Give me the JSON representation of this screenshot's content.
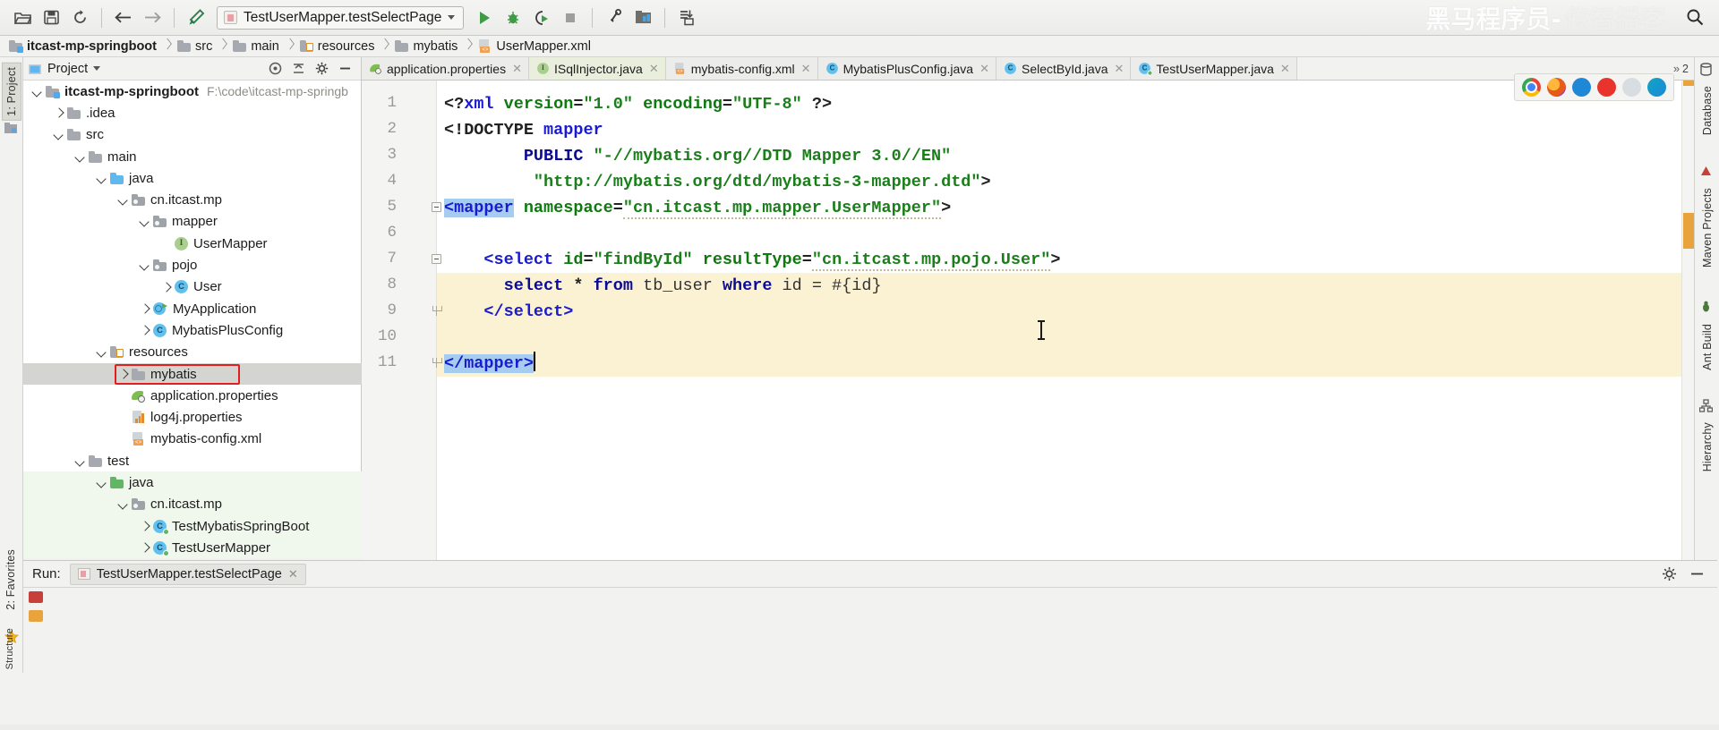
{
  "toolbar": {
    "icons": [
      "open-folder-icon",
      "save-all-icon",
      "sync-icon",
      "back-arrow-icon",
      "forward-arrow-icon",
      "build-hammer-icon"
    ],
    "run_configuration": "TestUserMapper.testSelectPage",
    "run_label": "Run",
    "debug_label": "Debug",
    "run_coverage_label": "Run with Coverage",
    "stop_label": "Stop",
    "settings_label": "Settings",
    "project_structure_label": "Project Structure",
    "update_label": "Update",
    "search_label": "Search Everywhere",
    "watermark": "黑马程序员-",
    "watermark_faint": "传智播客"
  },
  "breadcrumb": [
    {
      "label": "itcast-mp-springboot",
      "icon": "module-folder-icon"
    },
    {
      "label": "src",
      "icon": "folder-icon"
    },
    {
      "label": "main",
      "icon": "folder-icon"
    },
    {
      "label": "resources",
      "icon": "resources-folder-icon"
    },
    {
      "label": "mybatis",
      "icon": "folder-icon"
    },
    {
      "label": "UserMapper.xml",
      "icon": "xml-file-icon"
    }
  ],
  "left_strip": {
    "project_tab": "1: Project",
    "structure_tab": "Structure",
    "favorites_tab": "2: Favorites"
  },
  "right_strip": {
    "database_tab": "Database",
    "maven_tab": "Maven Projects",
    "ant_tab": "Ant Build",
    "hierarchy_tab": "Hierarchy"
  },
  "project_panel": {
    "title": "Project",
    "collapse_icon": "collapse-all-icon",
    "locate_icon": "scroll-from-source-icon",
    "settings_icon": "gear-icon",
    "hide_icon": "hide-icon",
    "tree": [
      {
        "depth": 0,
        "arrow": "down",
        "icon": "module-folder-icon",
        "label": "itcast-mp-springboot",
        "bold": true,
        "path": "F:\\code\\itcast-mp-springb"
      },
      {
        "depth": 1,
        "arrow": "right",
        "icon": "folder-icon",
        "label": ".idea"
      },
      {
        "depth": 1,
        "arrow": "down",
        "icon": "folder-icon",
        "label": "src"
      },
      {
        "depth": 2,
        "arrow": "down",
        "icon": "folder-icon",
        "label": "main"
      },
      {
        "depth": 3,
        "arrow": "down",
        "icon": "source-folder-icon",
        "label": "java"
      },
      {
        "depth": 4,
        "arrow": "down",
        "icon": "package-icon",
        "label": "cn.itcast.mp"
      },
      {
        "depth": 5,
        "arrow": "down",
        "icon": "package-icon",
        "label": "mapper"
      },
      {
        "depth": 6,
        "arrow": "none",
        "icon": "interface-icon",
        "label": "UserMapper"
      },
      {
        "depth": 5,
        "arrow": "down",
        "icon": "package-icon",
        "label": "pojo"
      },
      {
        "depth": 6,
        "arrow": "right",
        "icon": "class-icon",
        "label": "User"
      },
      {
        "depth": 5,
        "arrow": "right",
        "icon": "spring-app-icon",
        "label": "MyApplication"
      },
      {
        "depth": 5,
        "arrow": "right",
        "icon": "class-icon",
        "label": "MybatisPlusConfig"
      },
      {
        "depth": 3,
        "arrow": "down",
        "icon": "resources-folder-icon",
        "label": "resources"
      },
      {
        "depth": 4,
        "arrow": "right",
        "icon": "folder-icon",
        "label": "mybatis",
        "selected": true,
        "annotated": true
      },
      {
        "depth": 4,
        "arrow": "none",
        "icon": "properties-icon",
        "label": "application.properties"
      },
      {
        "depth": 4,
        "arrow": "none",
        "icon": "log4j-icon",
        "label": "log4j.properties"
      },
      {
        "depth": 4,
        "arrow": "none",
        "icon": "xml-file-icon",
        "label": "mybatis-config.xml"
      },
      {
        "depth": 2,
        "arrow": "down",
        "icon": "folder-icon",
        "label": "test"
      },
      {
        "depth": 3,
        "arrow": "down",
        "icon": "test-folder-icon",
        "label": "java",
        "testbg": true
      },
      {
        "depth": 4,
        "arrow": "down",
        "icon": "package-icon",
        "label": "cn.itcast.mp",
        "testbg": true
      },
      {
        "depth": 5,
        "arrow": "right",
        "icon": "test-class-icon",
        "label": "TestMybatisSpringBoot",
        "testbg": true
      },
      {
        "depth": 5,
        "arrow": "right",
        "icon": "test-class-icon",
        "label": "TestUserMapper",
        "testbg": true
      }
    ]
  },
  "editor": {
    "tabs": [
      {
        "label": "application.properties",
        "icon": "properties-icon",
        "active": false
      },
      {
        "label": "ISqlInjector.java",
        "icon": "interface-icon",
        "active": true
      },
      {
        "label": "mybatis-config.xml",
        "icon": "xml-file-icon",
        "active": false
      },
      {
        "label": "MybatisPlusConfig.java",
        "icon": "class-icon",
        "active": false
      },
      {
        "label": "SelectById.java",
        "icon": "class-icon",
        "active": false
      },
      {
        "label": "TestUserMapper.java",
        "icon": "test-class-icon",
        "active": false
      }
    ],
    "tab_overflow_count": "2",
    "browsers": [
      "chrome-icon",
      "firefox-icon",
      "edge-legacy-icon",
      "opera-icon",
      "safari-icon",
      "edge-icon"
    ],
    "line_numbers": [
      "1",
      "2",
      "3",
      "4",
      "5",
      "6",
      "7",
      "8",
      "9",
      "10",
      "11"
    ],
    "lines": [
      {
        "n": 1,
        "segments": [
          {
            "t": "<?",
            "c": "punc"
          },
          {
            "t": "xml",
            "c": "tag"
          },
          {
            "t": " ",
            "c": "plain"
          },
          {
            "t": "version",
            "c": "attr"
          },
          {
            "t": "=",
            "c": "punc"
          },
          {
            "t": "\"1.0\"",
            "c": "val"
          },
          {
            "t": " ",
            "c": "plain"
          },
          {
            "t": "encoding",
            "c": "attr"
          },
          {
            "t": "=",
            "c": "punc"
          },
          {
            "t": "\"UTF-8\"",
            "c": "val"
          },
          {
            "t": " ?>",
            "c": "punc"
          }
        ]
      },
      {
        "n": 2,
        "segments": [
          {
            "t": "<!DOCTYPE ",
            "c": "punc"
          },
          {
            "t": "mapper",
            "c": "tag"
          }
        ]
      },
      {
        "n": 3,
        "segments": [
          {
            "t": "        ",
            "c": "plain"
          },
          {
            "t": "PUBLIC",
            "c": "dark"
          },
          {
            "t": " ",
            "c": "plain"
          },
          {
            "t": "\"-//mybatis.org//DTD Mapper 3.0//EN\"",
            "c": "val"
          }
        ]
      },
      {
        "n": 4,
        "segments": [
          {
            "t": "         ",
            "c": "plain"
          },
          {
            "t": "\"http://mybatis.org/dtd/mybatis-3-mapper.dtd\"",
            "c": "val"
          },
          {
            "t": ">",
            "c": "punc"
          }
        ]
      },
      {
        "n": 5,
        "segments": [
          {
            "t": "<mapper",
            "c": "tag",
            "sel": true
          },
          {
            "t": " ",
            "c": "plain"
          },
          {
            "t": "namespace",
            "c": "attr"
          },
          {
            "t": "=",
            "c": "punc"
          },
          {
            "t": "\"cn.itcast.mp.mapper.UserMapper\"",
            "c": "val",
            "squiggle": true
          },
          {
            "t": ">",
            "c": "punc"
          }
        ]
      },
      {
        "n": 6,
        "segments": []
      },
      {
        "n": 7,
        "segments": [
          {
            "t": "    ",
            "c": "plain"
          },
          {
            "t": "<select ",
            "c": "tag"
          },
          {
            "t": "id",
            "c": "attr"
          },
          {
            "t": "=",
            "c": "punc"
          },
          {
            "t": "\"findById\"",
            "c": "val"
          },
          {
            "t": " ",
            "c": "plain"
          },
          {
            "t": "resultType",
            "c": "attr"
          },
          {
            "t": "=",
            "c": "punc"
          },
          {
            "t": "\"cn.itcast.mp.pojo.User\"",
            "c": "val",
            "squiggle": true
          },
          {
            "t": ">",
            "c": "punc"
          }
        ]
      },
      {
        "n": 8,
        "highlight": true,
        "segments": [
          {
            "t": "      ",
            "c": "plain"
          },
          {
            "t": "select",
            "c": "kw"
          },
          {
            "t": " * ",
            "c": "punc"
          },
          {
            "t": "from",
            "c": "kw"
          },
          {
            "t": " ",
            "c": "plain"
          },
          {
            "t": "tb_user",
            "c": "plain"
          },
          {
            "t": " ",
            "c": "plain"
          },
          {
            "t": "where",
            "c": "kw"
          },
          {
            "t": " ",
            "c": "plain"
          },
          {
            "t": "id = #{id}",
            "c": "plain"
          }
        ]
      },
      {
        "n": 9,
        "highlight": true,
        "segments": [
          {
            "t": "    ",
            "c": "plain"
          },
          {
            "t": "</select>",
            "c": "tag"
          }
        ]
      },
      {
        "n": 10,
        "highlight": true,
        "segments": []
      },
      {
        "n": 11,
        "highlight": true,
        "segments": [
          {
            "t": "</mapper>",
            "c": "tag",
            "sel": true
          },
          {
            "t": "|caret|",
            "c": "caret"
          }
        ]
      }
    ]
  },
  "run_panel": {
    "run_label": "Run:",
    "tab_label": "TestUserMapper.testSelectPage",
    "close_icon": "close-icon",
    "gear_icon": "gear-icon",
    "minimize_icon": "minimize-icon"
  }
}
